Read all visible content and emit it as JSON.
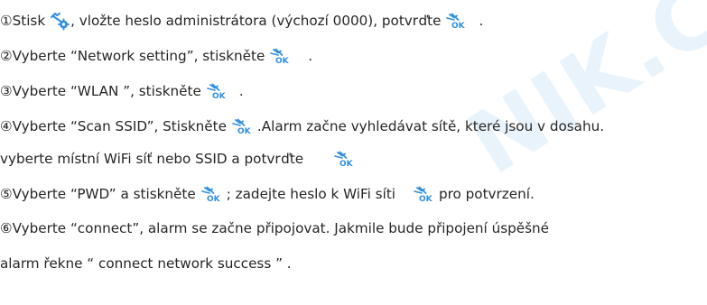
{
  "watermark": "NIK.CZ",
  "colors": {
    "accent": "#2f8fe0",
    "text": "#262626"
  },
  "icons": {
    "settings": "settings-arrow-gear-icon",
    "confirm": "ok-confirm-icon"
  },
  "steps": [
    {
      "a": "①Stisk",
      "b": ", vložte heslo administrátora (výchozí 0000), potvrďte",
      "c": "."
    },
    {
      "a": "②Vyberte “Network setting”, stiskněte",
      "b": "."
    },
    {
      "a": "③Vyberte “WLAN ”, stiskněte",
      "b": "."
    },
    {
      "a": "④Vyberte “Scan SSID”, Stiskněte",
      "b": ".Alarm začne vyhledávat sítě, které jsou v dosahu."
    },
    {
      "a": "vyberte místní WiFi síť nebo SSID a potvrďte"
    },
    {
      "a": "⑤Vyberte “PWD” a stiskněte",
      "b": "; zadejte heslo k WiFi síti",
      "c": "pro potvrzení."
    },
    {
      "a": "⑥Vyberte “connect”,  alarm se začne připojovat. Jakmile bude připojení úspěšné"
    },
    {
      "a": "alarm řekne “ connect network success ” ."
    }
  ]
}
